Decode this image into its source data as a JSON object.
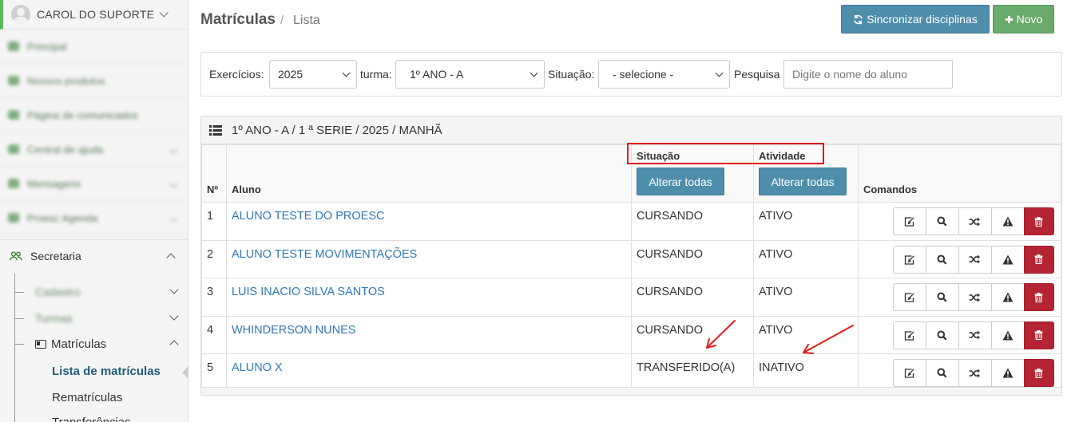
{
  "user": {
    "name": "CAROL DO SUPORTE"
  },
  "sidebar": {
    "blurred_items": [
      {
        "label": "Principal",
        "has_chevron": false
      },
      {
        "label": "Nossos produtos",
        "has_chevron": false
      },
      {
        "label": "Página de comunicados",
        "has_chevron": false
      },
      {
        "label": "Central de ajuda",
        "has_chevron": true
      },
      {
        "label": "Mensagens",
        "has_chevron": true
      },
      {
        "label": "Proesc Agenda",
        "has_chevron": true
      }
    ],
    "section": "Secretaria",
    "sub_blurred": [
      "Cadastro",
      "Turmas"
    ],
    "matriculas": "Matrículas",
    "lista_matriculas": "Lista de matrículas",
    "rematriculas": "Rematrículas",
    "transferencias": "Transferências"
  },
  "header": {
    "title": "Matrículas",
    "separator": "/",
    "breadcrumb": "Lista",
    "sync_label": "Sincronizar disciplinas",
    "new_label": "Novo"
  },
  "filters": {
    "exercicios_label": "Exercícios:",
    "exercicios_value": "2025",
    "turma_label": "turma:",
    "turma_value": "1º ANO - A",
    "situacao_label": "Situação:",
    "situacao_value": "- selecione -",
    "pesquisa_label": "Pesquisa",
    "pesquisa_placeholder": "Digite o nome do aluno"
  },
  "table": {
    "title": "1º ANO - A / 1 ª SERIE / 2025 / MANHÃ",
    "headers": {
      "num": "Nº",
      "aluno": "Aluno",
      "situacao": "Situação",
      "atividade": "Atividade",
      "comandos": "Comandos",
      "alterar_todas": "Alterar todas"
    },
    "rows": [
      {
        "num": "1",
        "aluno": "ALUNO TESTE DO PROESC",
        "situacao": "CURSANDO",
        "atividade": "ATIVO"
      },
      {
        "num": "2",
        "aluno": "ALUNO TESTE MOVIMENTAÇÕES",
        "situacao": "CURSANDO",
        "atividade": "ATIVO"
      },
      {
        "num": "3",
        "aluno": "LUIS INACIO SILVA SANTOS",
        "situacao": "CURSANDO",
        "atividade": "ATIVO"
      },
      {
        "num": "4",
        "aluno": "WHINDERSON NUNES",
        "situacao": "CURSANDO",
        "atividade": "ATIVO"
      },
      {
        "num": "5",
        "aluno": "ALUNO X",
        "situacao": "TRANSFERIDO(A)",
        "atividade": "INATIVO"
      }
    ]
  },
  "colors": {
    "primary_button": "#4f8eaa",
    "success_button": "#6aaa6a",
    "danger_button": "#b52433",
    "link": "#2f79b5",
    "annotation": "#e01b1b"
  }
}
